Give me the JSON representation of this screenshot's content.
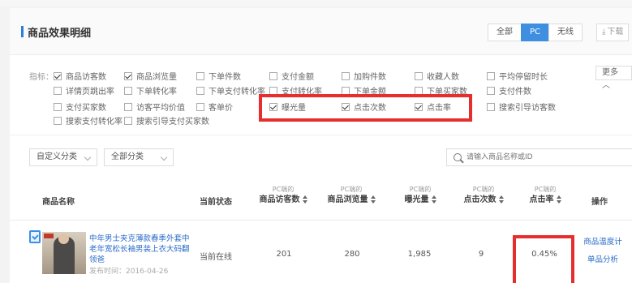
{
  "header": {
    "title": "商品效果明细",
    "segments": [
      "全部",
      "PC",
      "无线"
    ],
    "download_label": "下载"
  },
  "metrics": {
    "label": "指标：",
    "items": [
      {
        "label": "商品访客数",
        "checked": true
      },
      {
        "label": "商品浏览量",
        "checked": true
      },
      {
        "label": "下单件数",
        "checked": false
      },
      {
        "label": "支付金额",
        "checked": false
      },
      {
        "label": "加购件数",
        "checked": false
      },
      {
        "label": "收藏人数",
        "checked": false
      },
      {
        "label": "平均停留时长",
        "checked": false
      },
      {
        "label": "详情页跳出率",
        "checked": false
      },
      {
        "label": "下单转化率",
        "checked": false
      },
      {
        "label": "下单支付转化率",
        "checked": false
      },
      {
        "label": "支付转化率",
        "checked": false
      },
      {
        "label": "下单金额",
        "checked": false
      },
      {
        "label": "下单买家数",
        "checked": false
      },
      {
        "label": "支付件数",
        "checked": false
      },
      {
        "label": "支付买家数",
        "checked": false
      },
      {
        "label": "访客平均价值",
        "checked": false
      },
      {
        "label": "客单价",
        "checked": false
      },
      {
        "label": "曝光量",
        "checked": true
      },
      {
        "label": "点击次数",
        "checked": true
      },
      {
        "label": "点击率",
        "checked": true
      },
      {
        "label": "搜索引导访客数",
        "checked": false
      },
      {
        "label": "搜索支付转化率",
        "checked": false
      },
      {
        "label": "搜索引导支付买家数",
        "checked": false
      }
    ],
    "more_label": "更多"
  },
  "filters": {
    "category1": "自定义分类",
    "category2": "全部分类",
    "search_placeholder": "请输入商品名称或ID"
  },
  "table": {
    "headers": {
      "name": "商品名称",
      "status": "当前状态",
      "prefix": "PC端的",
      "visitors": "商品访客数",
      "views": "商品浏览量",
      "impressions": "曝光量",
      "clicks": "点击次数",
      "ctr": "点击率",
      "actions": "操作"
    },
    "rows": [
      {
        "title": "中年男士夹克薄款春季外套中老年宽松长袖男装上衣大码翻领爸",
        "publish_time": "发布时间：2016-04-26",
        "status": "当前在线",
        "visitors": "201",
        "views": "280",
        "impressions": "1,985",
        "clicks": "9",
        "ctr": "0.45%",
        "action1": "商品温度计",
        "action2": "单品分析"
      }
    ]
  },
  "colors": {
    "accent": "#3f8fe0",
    "highlight": "#e62e2e",
    "link": "#2a6cc8"
  }
}
